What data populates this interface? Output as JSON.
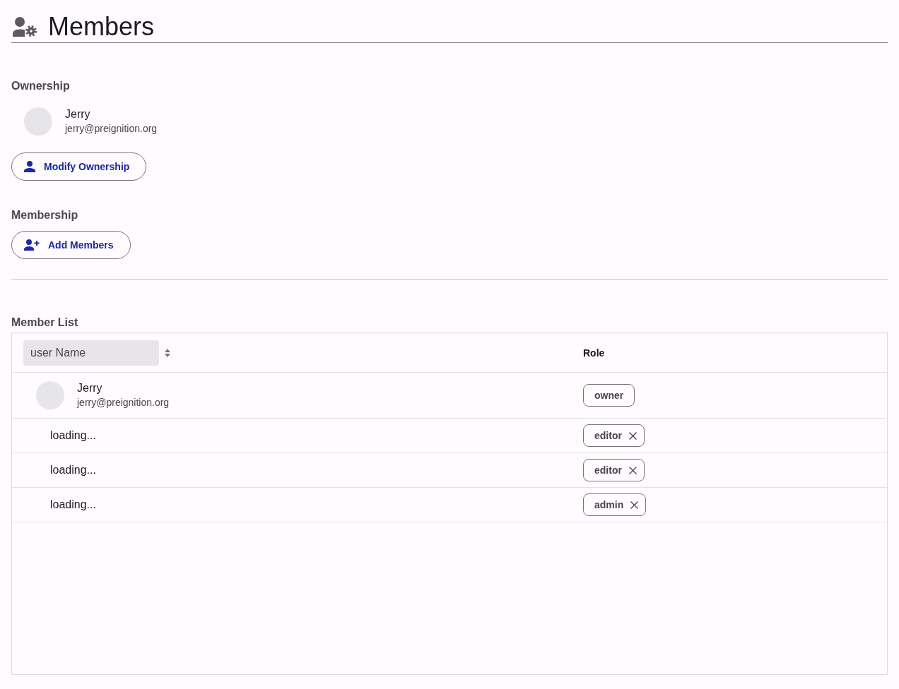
{
  "header": {
    "title": "Members"
  },
  "ownership": {
    "heading": "Ownership",
    "owner": {
      "name": "Jerry",
      "email": "jerry@preignition.org"
    },
    "button": "Modify Ownership"
  },
  "membership": {
    "heading": "Membership",
    "button": "Add Members"
  },
  "member_list": {
    "heading": "Member List",
    "columns": [
      {
        "label": "user Name",
        "sortable": true
      },
      {
        "label": "Role",
        "sortable": false
      }
    ],
    "rows": [
      {
        "kind": "user",
        "name": "Jerry",
        "email": "jerry@preignition.org",
        "role": "owner",
        "removable": false
      },
      {
        "kind": "loading",
        "text": "loading...",
        "role": "editor",
        "removable": true
      },
      {
        "kind": "loading",
        "text": "loading...",
        "role": "editor",
        "removable": true
      },
      {
        "kind": "loading",
        "text": "loading...",
        "role": "admin",
        "removable": true
      }
    ]
  }
}
